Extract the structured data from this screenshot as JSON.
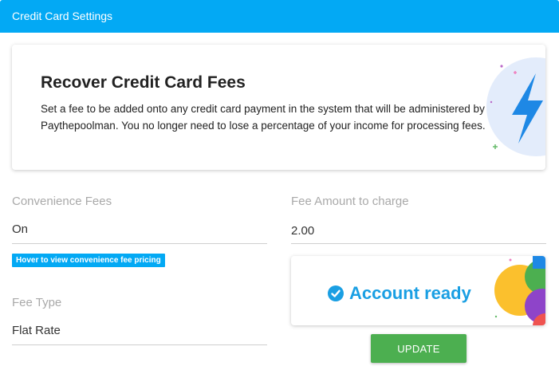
{
  "header": {
    "title": "Credit Card Settings"
  },
  "banner": {
    "heading": "Recover Credit Card Fees",
    "text": "Set a fee to be added onto any credit card payment in the system that will be administered by Paythepoolman. You no longer need to lose a percentage of your income for processing fees.",
    "icon": "lightning-bolt-icon"
  },
  "form": {
    "convenience_fees": {
      "label": "Convenience Fees",
      "value": "On"
    },
    "pricing_hint": "Hover to view convenience fee pricing",
    "fee_amount": {
      "label": "Fee Amount to charge",
      "value": "2.00"
    },
    "fee_type": {
      "label": "Fee Type",
      "value": "Flat Rate"
    }
  },
  "account": {
    "status": "Account ready",
    "icon": "check-circle-icon"
  },
  "actions": {
    "update_label": "UPDATE"
  },
  "colors": {
    "accent": "#03a9f4",
    "success": "#4caf50",
    "status_text": "#1a9fe3"
  }
}
